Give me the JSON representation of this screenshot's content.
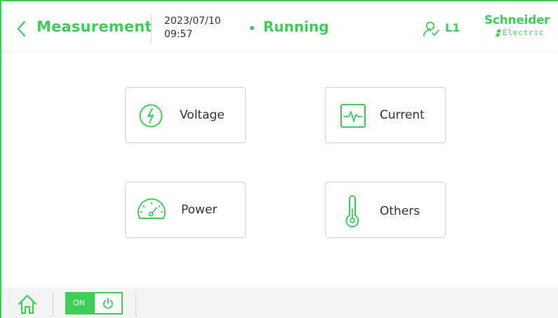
{
  "header": {
    "title": "Measurement",
    "date": "2023/07/10",
    "time": "09:57",
    "status": "Running",
    "user_level": "L1",
    "logo_top": "Schneider",
    "logo_bottom": "Electric"
  },
  "tiles": [
    {
      "label": "Voltage",
      "icon": "lightning-icon"
    },
    {
      "label": "Current",
      "icon": "waveform-icon"
    },
    {
      "label": "Power",
      "icon": "gauge-icon"
    },
    {
      "label": "Others",
      "icon": "thermometer-icon"
    }
  ],
  "footer": {
    "toggle_label": "ON"
  },
  "colors": {
    "accent": "#3dcd58",
    "text": "#333333",
    "border": "#d2d2d2"
  }
}
